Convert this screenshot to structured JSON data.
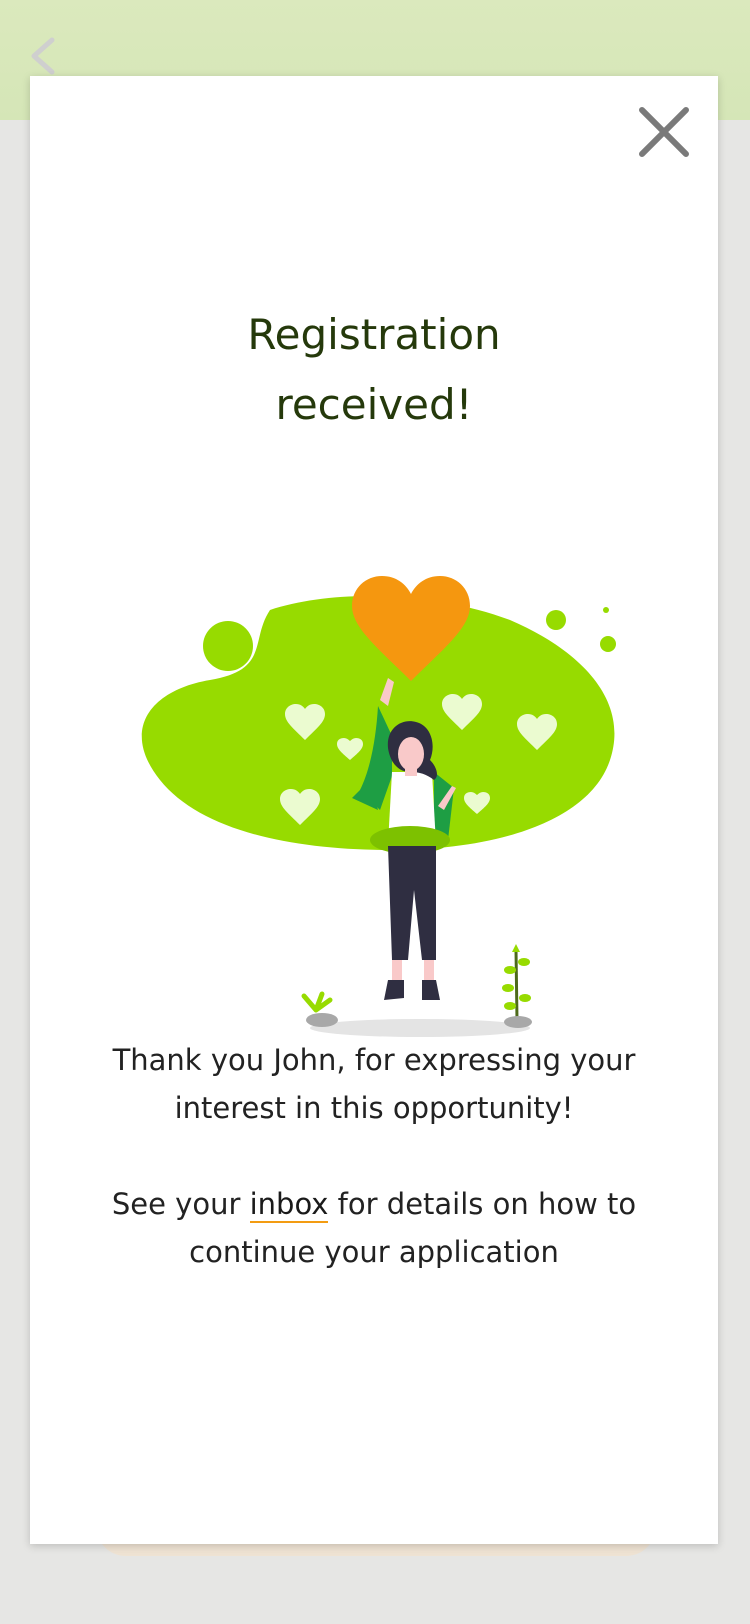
{
  "modal": {
    "title_line1": "Registration",
    "title_line2": "received!",
    "message_part1": "Thank you John, for expressing your interest in this opportunity!",
    "message_part2_prefix": "See your ",
    "inbox_link": "inbox",
    "message_part2_suffix": " for details on how to continue your application"
  },
  "colors": {
    "accent": "#f39c12",
    "blob_green": "#97db00",
    "title_text": "#25390b",
    "header_bg": "#d8e7ba"
  },
  "icons": {
    "close": "close-icon",
    "back": "chevron-left-icon",
    "illustration": "celebration-heart-illustration"
  }
}
